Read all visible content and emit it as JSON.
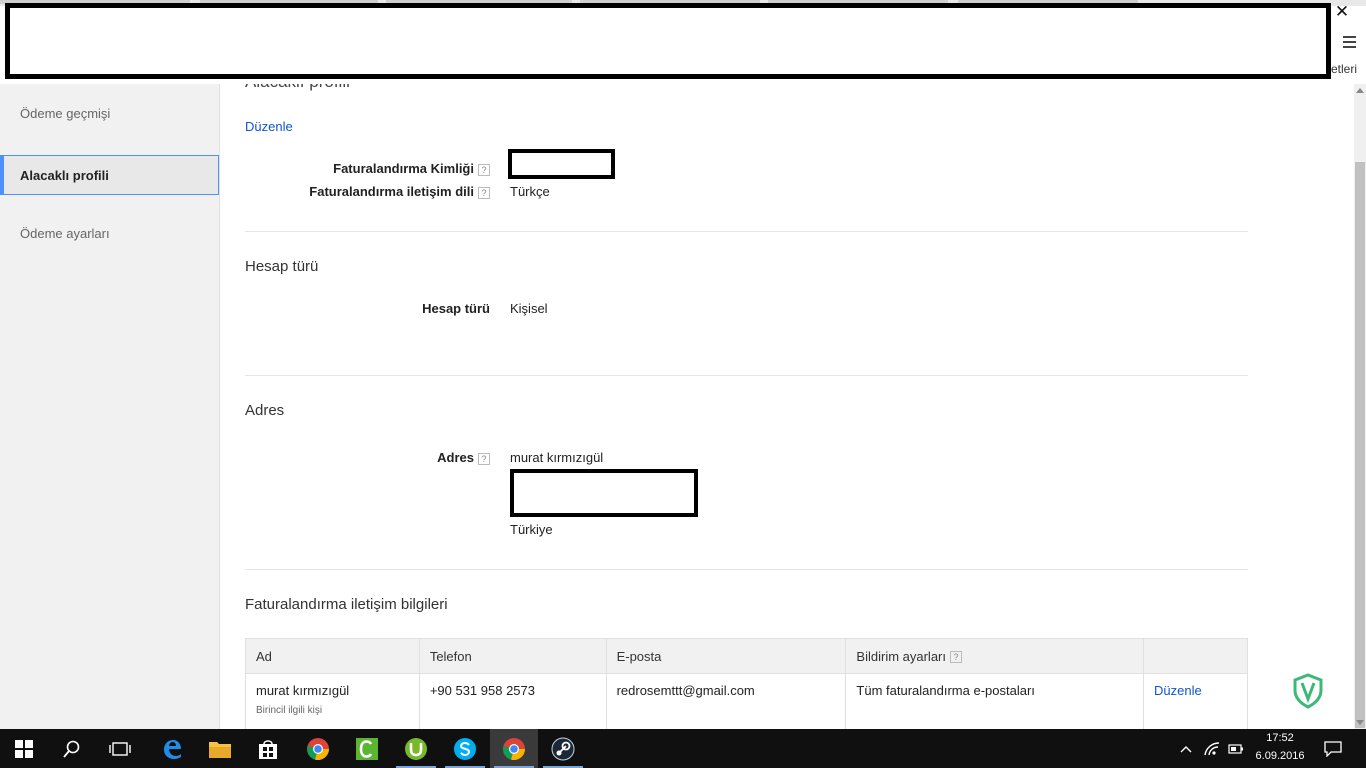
{
  "window": {
    "close_glyph": "✕",
    "menu_icon": "hamburger-menu-icon",
    "right_hint": "etleri"
  },
  "sidebar": {
    "items": [
      {
        "label": "Ödeme geçmişi"
      },
      {
        "label": "Alacaklı profili",
        "active": true
      },
      {
        "label": "Ödeme ayarları"
      }
    ]
  },
  "profile": {
    "title": "Alacaklı profili",
    "edit_link": "Düzenle",
    "billing_id_label": "Faturalandırma Kimliği",
    "billing_lang_label": "Faturalandırma iletişim dili",
    "billing_lang_value": "Türkçe"
  },
  "account_type": {
    "title": "Hesap türü",
    "label": "Hesap türü",
    "value": "Kişisel"
  },
  "address": {
    "title": "Adres",
    "label": "Adres",
    "name": "murat kırmızıgül",
    "country": "Türkiye"
  },
  "contacts": {
    "title": "Faturalandırma iletişim bilgileri",
    "headers": [
      "Ad",
      "Telefon",
      "E-posta",
      "Bildirim ayarları",
      ""
    ],
    "rows": [
      {
        "name": "murat kırmızıgül",
        "role": "Birincil ilgili kişi",
        "phone": "+90 531 958 2573",
        "email": "redrosemttt@gmail.com",
        "notifications": "Tüm faturalandırma e-postaları",
        "action": "Düzenle"
      }
    ]
  },
  "help_glyph": "?",
  "colors": {
    "link": "#1155cc",
    "active_border": "#4d90fe",
    "taskbar": "#101010"
  },
  "taskbar": {
    "apps": [
      "windows-start-icon",
      "search-icon",
      "task-view-icon",
      "edge-icon",
      "file-explorer-icon",
      "store-icon",
      "chrome-icon",
      "camtasia-icon",
      "utorrent-icon",
      "skype-icon",
      "chrome-icon",
      "steam-icon"
    ],
    "time": "17:52",
    "date": "6.09.2016"
  }
}
